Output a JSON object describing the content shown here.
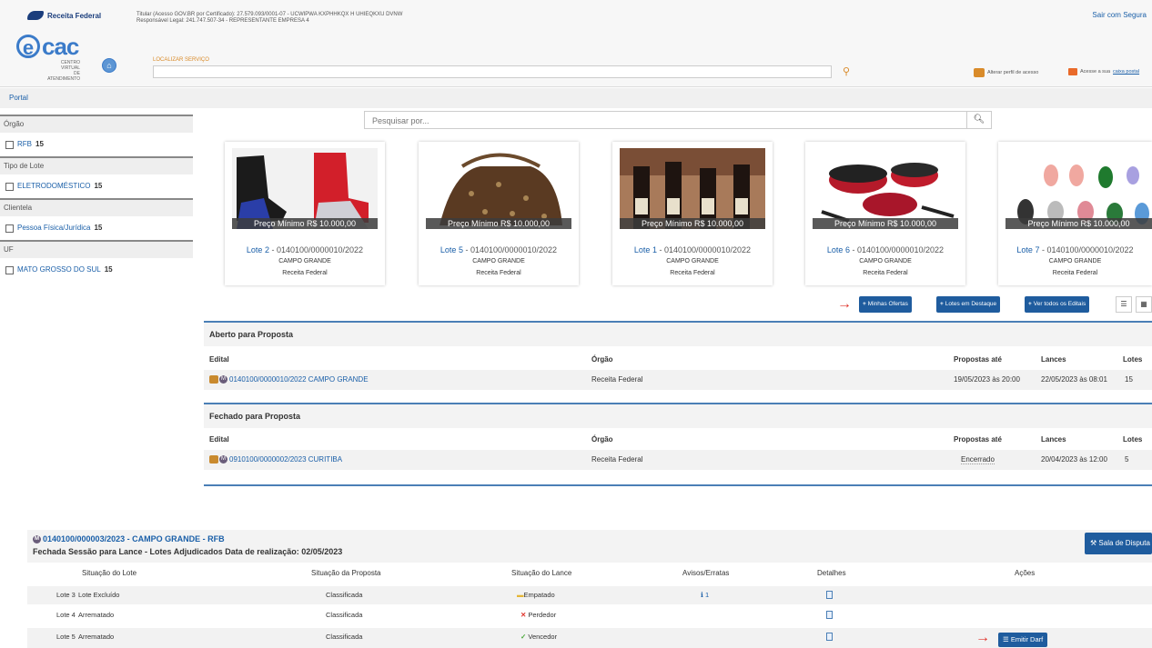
{
  "header": {
    "brand": "Receita Federal",
    "titular_line1": "Titular (Acesso GOV.BR por Certificado): 27.579.093/0001-07 - UCWIPWA KXPHHKQX H UHIEQKXU DVNW",
    "titular_line2": "Responsável Legal: 241.747.507-34 - REPRESENTANTE EMPRESA 4",
    "sair": "Sair com Segura",
    "ecac_sub1": "CENTRO VIRTUAL",
    "ecac_sub2": "DE ATENDIMENTO",
    "localizar_label": "LOCALIZAR SERVIÇO",
    "alterar_perfil": "Alterar perfil de acesso",
    "caixa_prefix": "Acesse a sua",
    "caixa_link": "caixa postal"
  },
  "portal": "Portal",
  "sidebar": {
    "groups": [
      {
        "title": "Órgão",
        "item": "RFB",
        "count": "15"
      },
      {
        "title": "Tipo de Lote",
        "item": "ELETRODOMÉSTICO",
        "count": "15"
      },
      {
        "title": "Clientela",
        "item": "Pessoa Física/Jurídica",
        "count": "15"
      },
      {
        "title": "UF",
        "item": "MATO GROSSO DO SUL",
        "count": "15"
      }
    ]
  },
  "search": {
    "placeholder": "Pesquisar por..."
  },
  "cards": [
    {
      "price": "Preço Mínimo R$ 10.000,00",
      "lote": "Lote 2",
      "code": " - 0140100/0000010/2022",
      "city": "CAMPO GRANDE",
      "org": "Receita Federal"
    },
    {
      "price": "Preço Mínimo R$ 10.000,00",
      "lote": "Lote 5",
      "code": " - 0140100/0000010/2022",
      "city": "CAMPO GRANDE",
      "org": "Receita Federal"
    },
    {
      "price": "Preço Mínimo R$ 10.000,00",
      "lote": "Lote 1",
      "code": " - 0140100/0000010/2022",
      "city": "CAMPO GRANDE",
      "org": "Receita Federal"
    },
    {
      "price": "Preço Mínimo R$ 10.000,00",
      "lote": "Lote 6",
      "code": " - 0140100/0000010/2022",
      "city": "CAMPO GRANDE",
      "org": "Receita Federal"
    },
    {
      "price": "Preço Mínimo R$ 10.000,00",
      "lote": "Lote 7",
      "code": " - 0140100/0000010/2022",
      "city": "CAMPO GRANDE",
      "org": "Receita Federal"
    }
  ],
  "buttons": {
    "minhas_ofertas": "Minhas Ofertas",
    "lotes_destaque": "Lotes em Destaque",
    "ver_editais": "Ver todos os Editais"
  },
  "aberto": {
    "title": "Aberto para Proposta",
    "cols": [
      "Edital",
      "Órgão",
      "Propostas até",
      "Lances",
      "Lotes"
    ],
    "row": {
      "edital": "0140100/0000010/2022 CAMPO GRANDE",
      "orgao": "Receita Federal",
      "propostas": "19/05/2023 às 20:00",
      "lances": "22/05/2023 às 08:01",
      "lotes": "15"
    }
  },
  "fechado": {
    "title": "Fechado para Proposta",
    "cols": [
      "Edital",
      "Órgão",
      "Propostas até",
      "Lances",
      "Lotes"
    ],
    "row": {
      "edital": "0910100/0000002/2023 CURITIBA",
      "orgao": "Receita Federal",
      "propostas": "Encerrado",
      "lances": "20/04/2023 às 12:00",
      "lotes": "5"
    }
  },
  "bottom": {
    "title": "0140100/000003/2023 - CAMPO GRANDE - RFB",
    "subtitle": "Fechada Sessão para Lance - Lotes Adjudicados Data de realização: 02/05/2023",
    "sala": "Sala de Disputa",
    "cols": [
      "Situação do Lote",
      "Situação da Proposta",
      "Situação do Lance",
      "Avisos/Erratas",
      "Detalhes",
      "Ações"
    ],
    "rows": [
      {
        "lote": "Lote 3",
        "situacao": "Lote Excluído",
        "proposta": "Classificada",
        "lance": "Empatado",
        "avisos": "1"
      },
      {
        "lote": "Lote 4",
        "situacao": "Arrematado",
        "proposta": "Classificada",
        "lance": "Perdedor",
        "avisos": ""
      },
      {
        "lote": "Lote 5",
        "situacao": "Arrematado",
        "proposta": "Classificada",
        "lance": "Vencedor",
        "avisos": ""
      }
    ],
    "emitir": "Emitir Darf"
  }
}
